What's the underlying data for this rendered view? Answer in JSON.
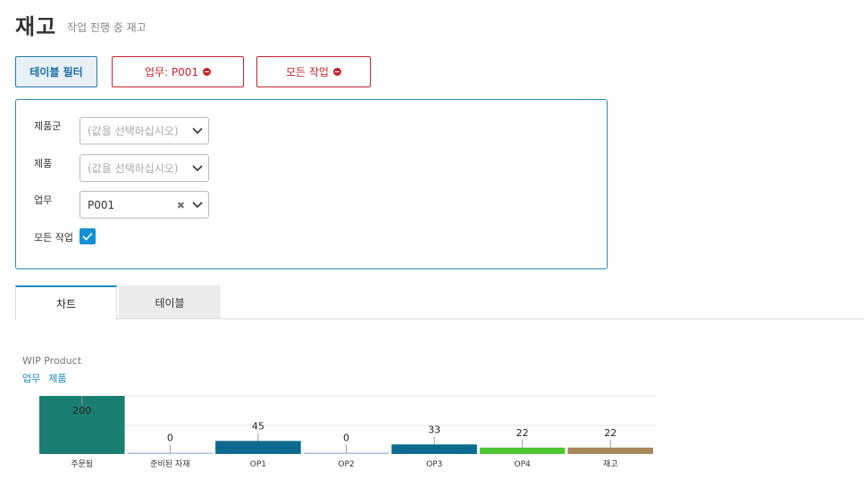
{
  "header": {
    "title": "재고",
    "subtitle": "작업 진행 중 재고"
  },
  "toolbar": {
    "table_filter_label": "테이블 필터",
    "active_filters": [
      {
        "label": "업무: P001"
      },
      {
        "label": "모든 작업"
      }
    ]
  },
  "filter_panel": {
    "product_group": {
      "label": "제품군",
      "placeholder": "(값을 선택하십시오)"
    },
    "product": {
      "label": "제품",
      "placeholder": "(값을 선택하십시오)"
    },
    "task": {
      "label": "업무",
      "value": "P001"
    },
    "all_tasks": {
      "label": "모든 작업",
      "checked": true
    }
  },
  "tabs": {
    "chart": "차트",
    "table": "테이블"
  },
  "chart_panel": {
    "title": "WIP Product",
    "links": [
      "업무",
      "제품"
    ]
  },
  "chart_data": {
    "type": "bar",
    "title": "WIP Product",
    "categories": [
      "주문됨",
      "준비된 자재",
      "OP1",
      "OP2",
      "OP3",
      "OP4",
      "재고"
    ],
    "values": [
      200,
      0,
      45,
      0,
      33,
      22,
      22
    ],
    "colors": [
      "#1a7e70",
      "#a7c4d2",
      "#0c6a8e",
      "#a7c4d2",
      "#0c6a8e",
      "#4fc634",
      "#a88858"
    ],
    "ylim": [
      0,
      200
    ],
    "grid": true
  }
}
